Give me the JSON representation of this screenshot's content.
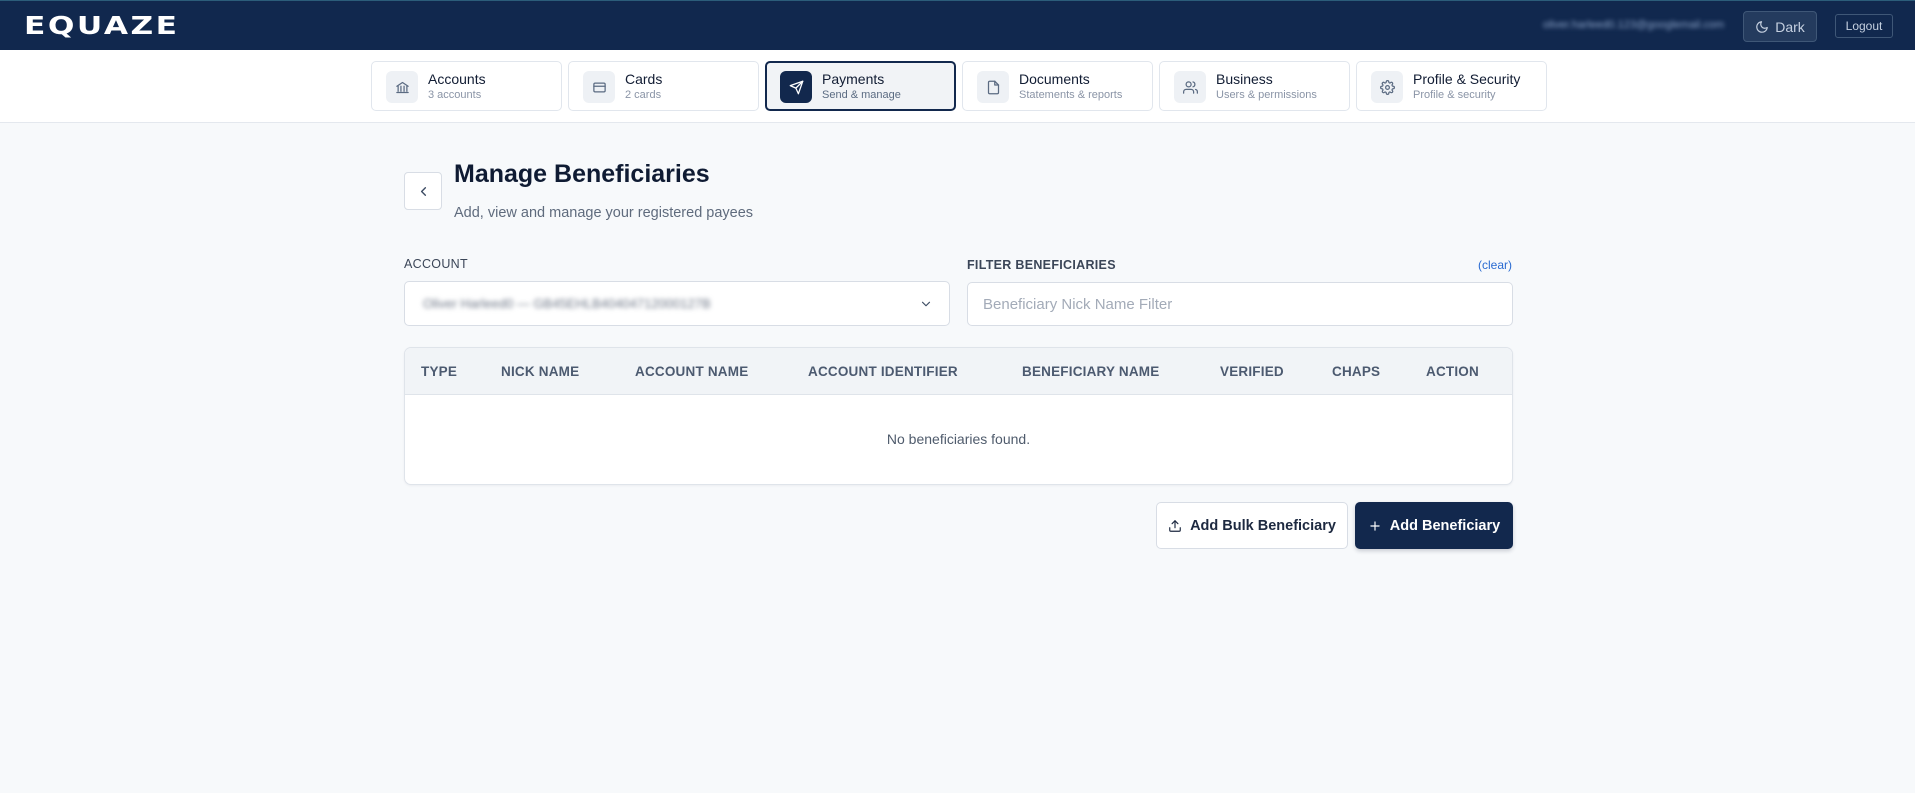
{
  "app": {
    "logo": "EQUAZE"
  },
  "header": {
    "user_email": "oliver.harleed0.123@googlemail.com",
    "dark_label": "Dark",
    "logout_label": "Logout"
  },
  "nav": {
    "tabs": [
      {
        "label": "Accounts",
        "sub": "3 accounts",
        "icon": "bank-icon"
      },
      {
        "label": "Cards",
        "sub": "2 cards",
        "icon": "card-icon"
      },
      {
        "label": "Payments",
        "sub": "Send & manage",
        "icon": "send-icon",
        "active": true
      },
      {
        "label": "Documents",
        "sub": "Statements & reports",
        "icon": "document-icon"
      },
      {
        "label": "Business",
        "sub": "Users & permissions",
        "icon": "users-icon"
      },
      {
        "label": "Profile & Security",
        "sub": "Profile & security",
        "icon": "gear-icon"
      }
    ]
  },
  "page": {
    "title": "Manage Beneficiaries",
    "subtitle": "Add, view and manage your registered payees"
  },
  "filters": {
    "account_label": "ACCOUNT",
    "account_value": "Oliver Harleed0 — GB45EHLB40404712000127B",
    "filter_label": "FILTER BENEFICIARIES",
    "clear_label": "(clear)",
    "filter_placeholder": "Beneficiary Nick Name Filter",
    "filter_value": ""
  },
  "table": {
    "columns": [
      "TYPE",
      "NICK NAME",
      "ACCOUNT NAME",
      "ACCOUNT IDENTIFIER",
      "BENEFICIARY NAME",
      "VERIFIED",
      "CHAPS",
      "ACTION"
    ],
    "rows": [],
    "empty_message": "No beneficiaries found."
  },
  "actions": {
    "bulk_label": "Add Bulk Beneficiary",
    "add_label": "Add Beneficiary"
  },
  "colors": {
    "primary": "#12284d",
    "link": "#2a6bd1",
    "background": "#f7f9fb"
  }
}
